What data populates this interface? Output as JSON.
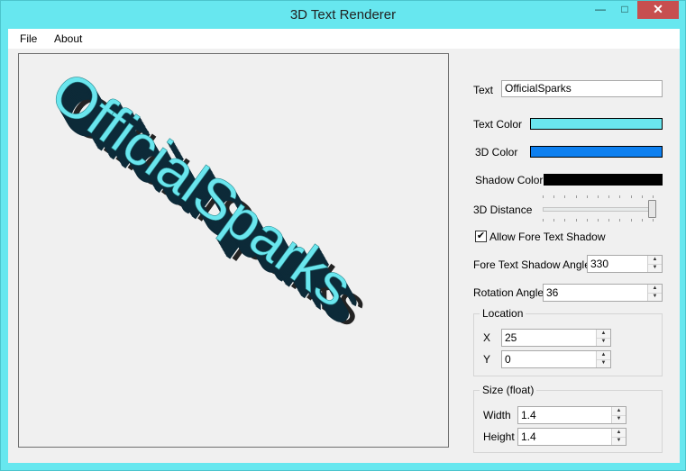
{
  "window": {
    "title": "3D Text Renderer",
    "min_glyph": "—",
    "max_glyph": "□",
    "close_glyph": "✕"
  },
  "menu": {
    "file": "File",
    "about": "About"
  },
  "render": {
    "text": "OfficialSparks",
    "text_color": "#6ae6ee",
    "shadow_color": "#000000",
    "depth_color": "#0d2a38",
    "rotation_angle": 36
  },
  "controls": {
    "text_label": "Text",
    "text_value": "OfficialSparks",
    "text_color_label": "Text Color",
    "text_color": "#6ae6ee",
    "color3d_label": "3D Color",
    "color3d": "#0e80f0",
    "shadow_color_label": "Shadow Color",
    "shadow_color": "#000000",
    "distance_label": "3D Distance",
    "distance_fraction": 1.0,
    "shadow_check_label": "Allow Fore Text Shadow",
    "shadow_checked": true,
    "shadow_angle_label": "Fore Text Shadow Angle",
    "shadow_angle": "330",
    "rotation_label": "Rotation Angle",
    "rotation": "36"
  },
  "location": {
    "title": "Location",
    "x_label": "X",
    "x": "25",
    "y_label": "Y",
    "y": "0"
  },
  "size": {
    "title": "Size (float)",
    "width_label": "Width",
    "width": "1.4",
    "height_label": "Height",
    "height": "1.4"
  }
}
